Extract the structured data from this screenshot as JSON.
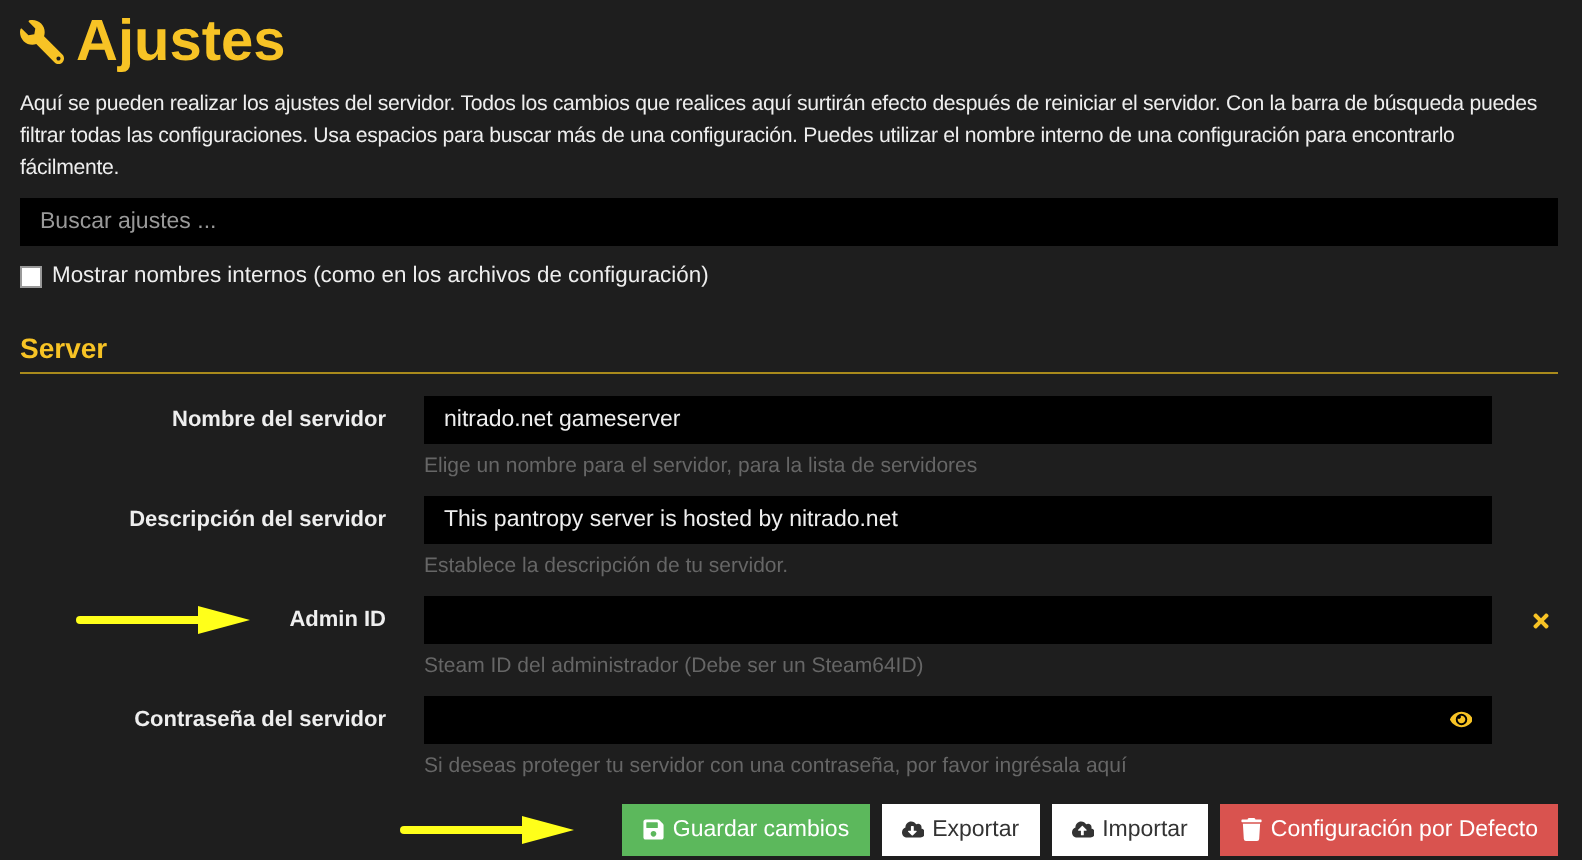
{
  "title": "Ajustes",
  "intro": "Aquí se pueden realizar los ajustes del servidor. Todos los cambios que realices aquí surtirán efecto después de reiniciar el servidor. Con la barra de búsqueda puedes filtrar todas las configuraciones. Usa espacios para buscar más de una configuración. Puedes utilizar el nombre interno de una configuración para encontrarlo fácilmente.",
  "search": {
    "placeholder": "Buscar ajustes ..."
  },
  "show_internal": {
    "label": "Mostrar nombres internos (como en los archivos de configuración)",
    "checked": false
  },
  "section": {
    "title": "Server",
    "fields": [
      {
        "kind": "text",
        "label": "Nombre del servidor",
        "value": "nitrado.net gameserver",
        "help": "Elige un nombre para el servidor, para la lista de servidores"
      },
      {
        "kind": "text",
        "label": "Descripción del servidor",
        "value": "This pantropy server is hosted by nitrado.net",
        "help": "Establece la descripción de tu servidor."
      },
      {
        "kind": "clearable",
        "label": "Admin ID",
        "help": "Steam ID del administrador (Debe ser un Steam64ID)",
        "pointer": true
      },
      {
        "kind": "password",
        "label": "Contraseña del servidor",
        "help": "Si deseas proteger tu servidor con una contraseña, por favor ingrésala aquí"
      }
    ]
  },
  "buttons": [
    {
      "kind": "save",
      "label": "Guardar cambios",
      "pointer": true
    },
    {
      "kind": "export",
      "label": "Exportar"
    },
    {
      "kind": "import",
      "label": "Importar"
    },
    {
      "kind": "reset",
      "label": "Configuración por Defecto"
    }
  ]
}
